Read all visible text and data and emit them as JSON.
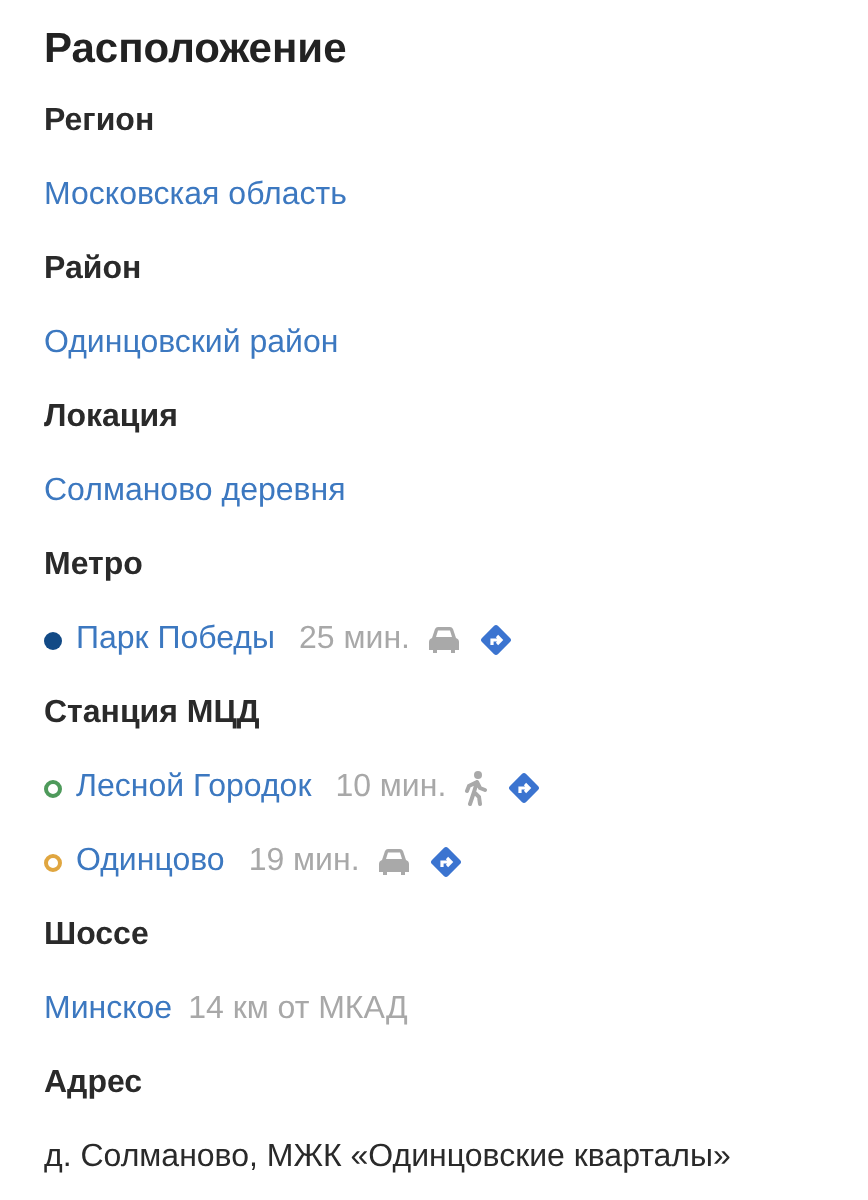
{
  "title": "Расположение",
  "sections": [
    {
      "label": "Регион",
      "kind": "link",
      "value": "Московская область"
    },
    {
      "label": "Район",
      "kind": "link",
      "value": "Одинцовский район"
    },
    {
      "label": "Локация",
      "kind": "link",
      "value": "Солманово деревня"
    },
    {
      "label": "Метро",
      "kind": "stations",
      "stations": [
        {
          "name": "Парк Победы",
          "filled": true,
          "color": "#124a86",
          "time": "25 мин.",
          "kind": "car"
        }
      ]
    },
    {
      "label": "Станция МЦД",
      "kind": "stations",
      "stations": [
        {
          "name": "Лесной Городок",
          "filled": false,
          "color": "#4e9a5b",
          "time": "10 мин.",
          "kind": "walk"
        },
        {
          "name": "Одинцово",
          "filled": false,
          "color": "#e0a640",
          "time": "19 мин.",
          "kind": "car"
        }
      ]
    },
    {
      "label": "Шоссе",
      "kind": "highway",
      "value": "Минское",
      "distance": "14 км от МКАД"
    },
    {
      "label": "Адрес",
      "kind": "plain",
      "value": "д. Солманово, МЖК «Одинцовские кварталы»"
    }
  ]
}
